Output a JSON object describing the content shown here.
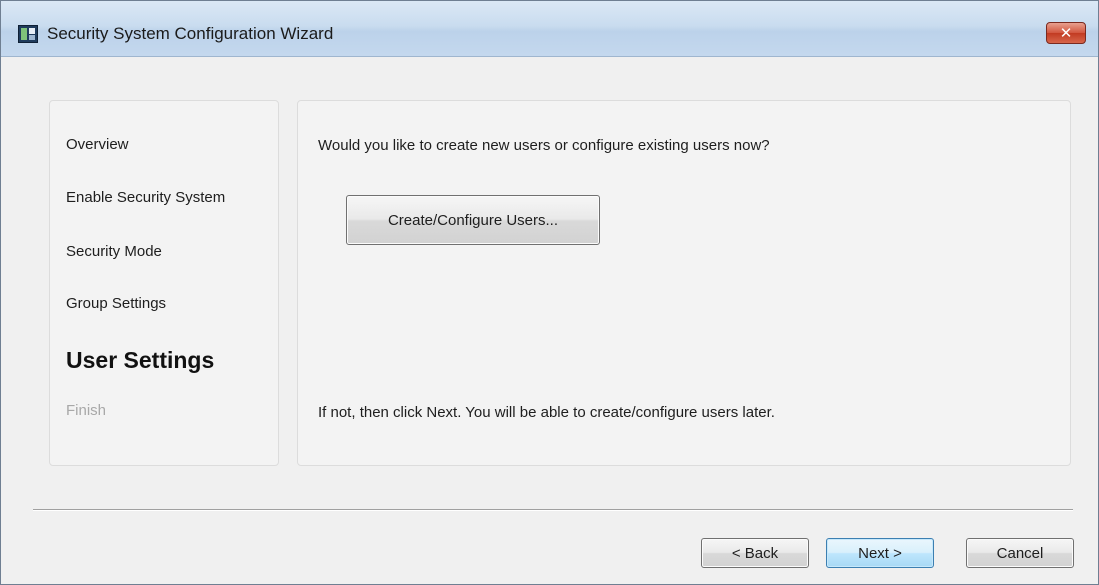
{
  "window": {
    "title": "Security System Configuration Wizard",
    "close_label": "✕"
  },
  "steps": [
    {
      "label": "Overview",
      "state": "normal"
    },
    {
      "label": "Enable Security System",
      "state": "normal"
    },
    {
      "label": "Security Mode",
      "state": "normal"
    },
    {
      "label": "Group Settings",
      "state": "normal"
    },
    {
      "label": "User Settings",
      "state": "active"
    },
    {
      "label": "Finish",
      "state": "disabled"
    }
  ],
  "content": {
    "question": "Would you like to create new users or configure existing users now?",
    "create_button_label": "Create/Configure Users...",
    "later_note": "If not, then click Next. You will be able to create/configure users later."
  },
  "buttons": {
    "back_label": "< Back",
    "next_label": "Next >",
    "cancel_label": "Cancel"
  },
  "colors": {
    "title_bar": "#c9dcef",
    "close_button": "#c23b22",
    "default_button_border": "#3c7fb1",
    "disabled_text": "#a8a8a8"
  }
}
